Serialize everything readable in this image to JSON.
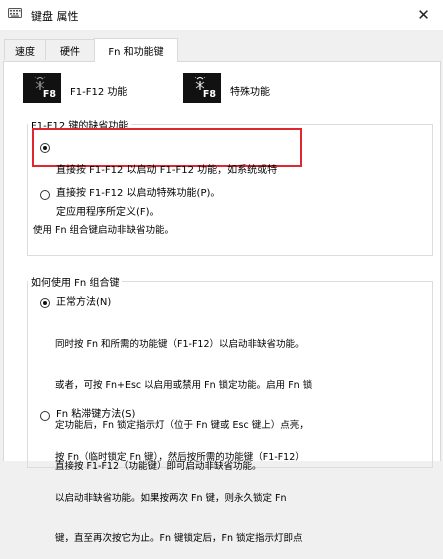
{
  "window": {
    "title": "键盘 属性",
    "close_symbol": "✕"
  },
  "tabs": [
    {
      "label": "速度",
      "active": false
    },
    {
      "label": "硬件",
      "active": false
    },
    {
      "label": "Fn 和功能键",
      "active": true
    }
  ],
  "fkeys": {
    "standard": {
      "key_label": "F8",
      "label": "F1-F12 功能",
      "icon": "antenna-icon"
    },
    "special": {
      "key_label": "F8",
      "label": "特殊功能",
      "icon": "antenna-icon"
    }
  },
  "default_group": {
    "title": "F1-F12 键的缺省功能",
    "options": [
      {
        "label_line1": "直接按 F1-F12 以启动 F1-F12 功能，如系统或特",
        "label_line2": "定应用程序所定义(F)。",
        "checked": true
      },
      {
        "label_line1": "直接按 F1-F12 以启动特殊功能(P)。",
        "checked": false
      }
    ],
    "note": "使用 Fn 组合键启动非缺省功能。"
  },
  "fn_group": {
    "title": "如何使用 Fn 组合键",
    "normal": {
      "label": "正常方法(N)",
      "checked": true,
      "desc": [
        "同时按 Fn 和所需的功能键（F1-F12）以启动非缺省功能。",
        "或者，可按 Fn+Esc 以启用或禁用 Fn 锁定功能。启用 Fn 锁",
        "定功能后，Fn 锁定指示灯（位于 Fn 键或 Esc 键上）点亮，",
        "直接按 F1-F12（功能键）即可启动非缺省功能。"
      ]
    },
    "sticky": {
      "label": "Fn 粘滞键方法(S)",
      "checked": false,
      "desc": [
        "按 Fn（临时锁定 Fn 键），然后按所需的功能键（F1-F12）",
        "以启动非缺省功能。如果按两次 Fn 键，则永久锁定 Fn",
        "键，直至再次按它为止。Fn 键锁定后，Fn 锁定指示灯即点"
      ]
    }
  },
  "colors": {
    "highlight": "#e0262e"
  }
}
